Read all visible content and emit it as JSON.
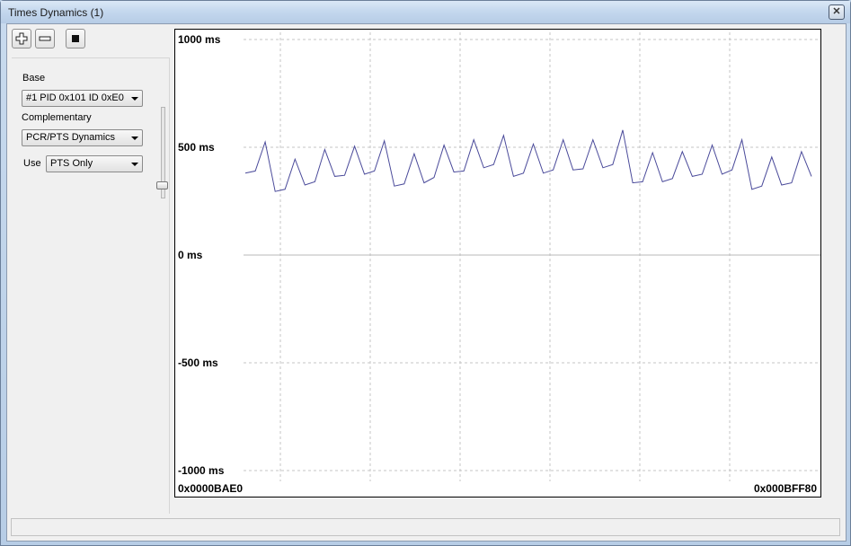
{
  "window": {
    "title": "Times Dynamics (1)",
    "close_glyph": "✕"
  },
  "toolbar": {
    "buttons": [
      "add-icon",
      "remove-icon",
      "stop-icon"
    ]
  },
  "panel": {
    "base_label": "Base",
    "base_value": "#1 PID 0x101 ID 0xE0",
    "complementary_label": "Complementary",
    "complementary_value": "PCR/PTS Dynamics",
    "use_label": "Use",
    "use_value": "PTS Only"
  },
  "chart_data": {
    "type": "line",
    "y_tick_labels": [
      "1000 ms",
      "500 ms",
      "0 ms",
      "-500 ms",
      "-1000 ms"
    ],
    "y_ticks": [
      1000,
      500,
      0,
      -500,
      -1000
    ],
    "ylim": [
      -1000,
      1000
    ],
    "x_start_label": "0x0000BAE0",
    "x_end_label": "0x000BFF80",
    "grid": true,
    "series_color": "#4a4a9a",
    "series": [
      {
        "values": [
          380,
          390,
          525,
          295,
          305,
          445,
          325,
          340,
          490,
          365,
          370,
          505,
          375,
          390,
          530,
          320,
          330,
          470,
          335,
          360,
          510,
          385,
          390,
          535,
          405,
          420,
          555,
          365,
          380,
          515,
          380,
          395,
          535,
          395,
          400,
          535,
          405,
          420,
          580,
          335,
          340,
          475,
          340,
          355,
          480,
          365,
          375,
          510,
          375,
          395,
          535,
          305,
          320,
          455,
          325,
          335,
          480,
          365
        ]
      }
    ]
  }
}
